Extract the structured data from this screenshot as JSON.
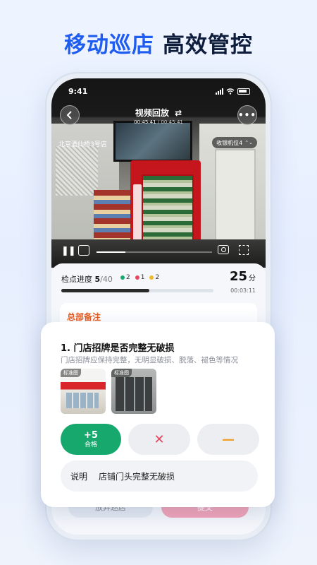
{
  "headline": {
    "part1": "移动巡店",
    "part2": "高效管控"
  },
  "status_bar": {
    "time": "9:41"
  },
  "player": {
    "title": "视频回放",
    "switch_icon": "swap-icon",
    "current_time": "00:45:41",
    "total_time": "00:45:41",
    "store_name": "北京酒仙桥3号店",
    "camera": "收银机位4",
    "progress": 0.25
  },
  "inspection": {
    "progress_label": "检点进度",
    "done": "5",
    "total": "/40",
    "counts": [
      {
        "color": "#17a86e",
        "value": "2"
      },
      {
        "color": "#e8455c",
        "value": "1"
      },
      {
        "color": "#f0b92a",
        "value": "2"
      }
    ],
    "progress": 0.58,
    "score": "25",
    "score_unit": "分",
    "elapsed": "00:03:11",
    "note_title": "总部备注"
  },
  "item": {
    "title": "1. 门店招牌是否完整无破损",
    "desc": "门店招牌应保持完整，无明显破损、脱落、褪色等情况",
    "image_tag": "标准图",
    "pass_points": "+5",
    "pass_label": "合格",
    "fail_symbol": "✕",
    "na_symbol": "—",
    "remark_key": "说明",
    "remark_value": "店铺门头完整无破损"
  },
  "footer": {
    "left": "放弃巡店",
    "right": "提交"
  },
  "colors": {
    "accent": "#1f5cf0",
    "pass": "#17a86e",
    "fail": "#e8455c",
    "na": "#f0a02a",
    "note": "#e85a1f"
  }
}
